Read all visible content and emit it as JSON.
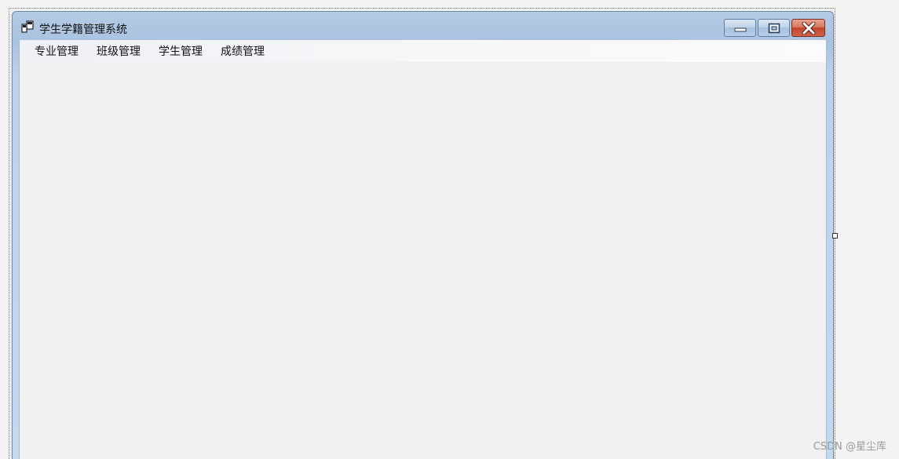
{
  "window": {
    "title": "学生学籍管理系统",
    "icon": "app-form-icon",
    "buttons": {
      "minimize_icon": "minimize-icon",
      "maximize_icon": "maximize-icon",
      "close_icon": "close-icon"
    }
  },
  "menu": {
    "items": [
      {
        "label": "专业管理"
      },
      {
        "label": "班级管理"
      },
      {
        "label": "学生管理"
      },
      {
        "label": "成绩管理"
      }
    ]
  },
  "watermark": "CSDN @星尘库",
  "colors": {
    "title_bar": "#b4cbe3",
    "client": "#f0f0f0",
    "close_button": "#c4462b"
  }
}
